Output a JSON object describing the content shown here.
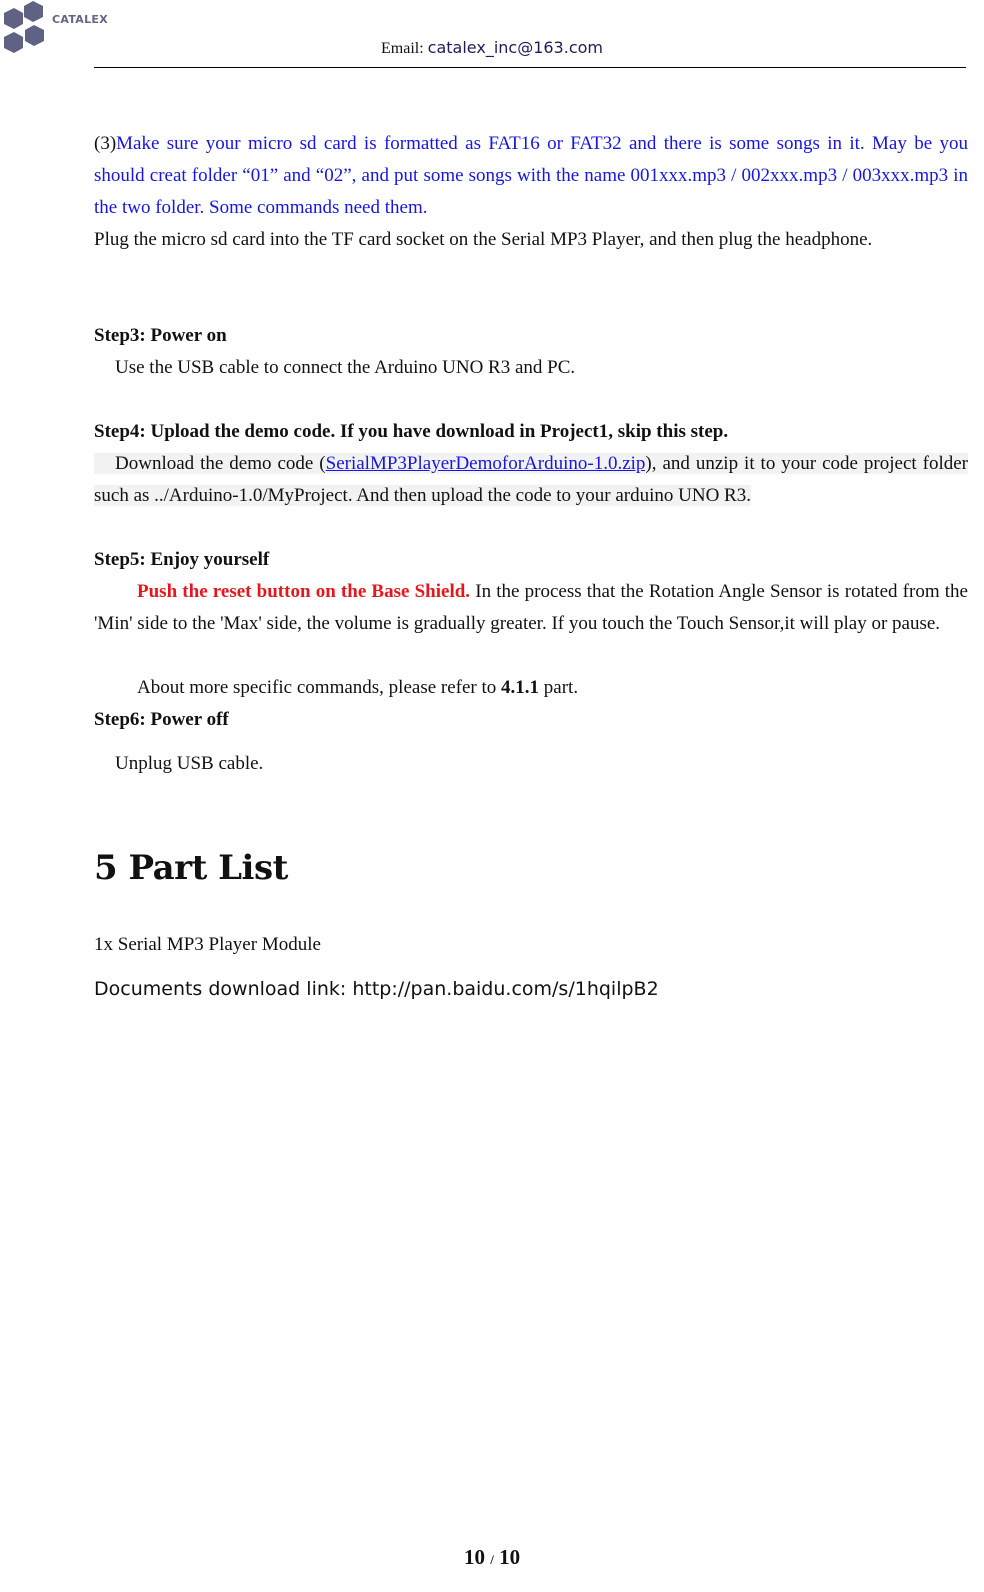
{
  "header": {
    "logo_text": "CATALEX",
    "email_label": "Email:",
    "email_value": "catalex_inc@163.com"
  },
  "section3": {
    "prefix": "(3)",
    "blue_text": "Make sure your micro sd card is formatted as FAT16 or FAT32 and there is some songs in it. May be you should creat folder “01” and “02”, and put some songs with the name 001xxx.mp3 / 002xxx.mp3 / 003xxx.mp3 in the two folder. Some commands need them.",
    "plug_text": "Plug the micro sd card into the TF card socket on the Serial MP3 Player, and then plug the headphone."
  },
  "step3": {
    "heading": "Step3: Power on",
    "body": "Use the USB cable to connect the Arduino UNO R3 and PC."
  },
  "step4": {
    "heading": "Step4: Upload the demo code. If you have download in Project1, skip this step.",
    "body_before": "Download the demo code (",
    "link_text": "SerialMP3PlayerDemoforArduino-1.0.zip",
    "body_after": "), and unzip it to your code project folder such as ../Arduino-1.0/MyProject. And then upload the code to your arduino UNO R3."
  },
  "step5": {
    "heading": "Step5: Enjoy yourself",
    "red_text": "Push the reset button on the Base Shield.",
    "body": " In the process that the Rotation Angle Sensor is rotated from the 'Min' side to the 'Max' side, the volume is gradually greater. If you touch the Touch Sensor,it will play or pause.",
    "more_before": "About more specific commands, please refer to ",
    "more_bold": "4.1.1",
    "more_after": " part."
  },
  "step6": {
    "heading": "Step6: Power off",
    "body": "Unplug USB cable."
  },
  "part_list": {
    "title": "5 Part List",
    "item": "1x Serial MP3 Player Module",
    "download": "Documents download link: http://pan.baidu.com/s/1hqilpB2"
  },
  "footer": {
    "page_current": "10",
    "separator": "/",
    "page_total": "10"
  }
}
